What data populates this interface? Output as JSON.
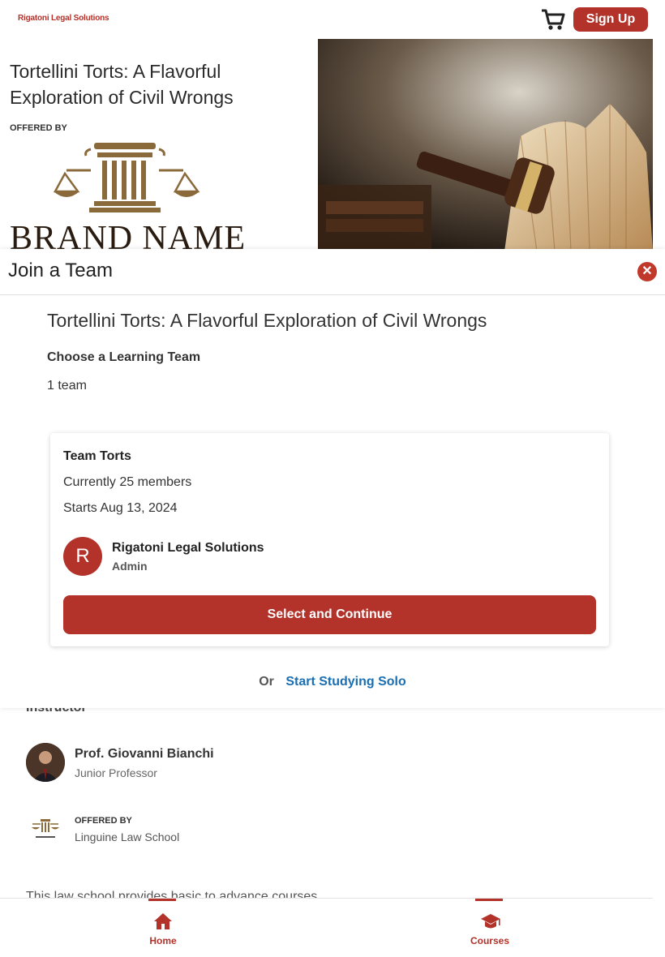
{
  "header": {
    "brand": "Rigatoni Legal Solutions",
    "cart_icon": "shopping-cart-icon",
    "signup_label": "Sign Up"
  },
  "background": {
    "course_title": "Tortellini Torts: A Flavorful Exploration of Civil Wrongs",
    "offered_by": "OFFERED BY",
    "logo_text": "BRAND NAME",
    "instructor_heading": "Instructor",
    "instructor": {
      "name": "Prof. Giovanni Bianchi",
      "role": "Junior Professor"
    },
    "school": {
      "offered_by": "OFFERED BY",
      "name": "Linguine Law School"
    },
    "about": "This law school provides basic to advance courses."
  },
  "modal": {
    "title": "Join a Team",
    "close_icon": "close-icon",
    "course_title": "Tortellini Torts: A Flavorful Exploration of Civil Wrongs",
    "choose_label": "Choose a Learning Team",
    "team_count": "1 team",
    "team": {
      "name": "Team Torts",
      "members": "Currently 25 members",
      "starts": "Starts Aug 13, 2024",
      "admin": {
        "initial": "R",
        "name": "Rigatoni Legal Solutions",
        "role": "Admin"
      },
      "select_label": "Select and Continue"
    },
    "or_label": "Or",
    "solo_label": "Start Studying Solo"
  },
  "bottom_nav": {
    "items": [
      {
        "label": "Home",
        "icon": "home-icon"
      },
      {
        "label": "Courses",
        "icon": "graduation-cap-icon"
      }
    ]
  },
  "colors": {
    "accent": "#b3322a",
    "link": "#1a6fb3",
    "close": "#c0392b"
  }
}
